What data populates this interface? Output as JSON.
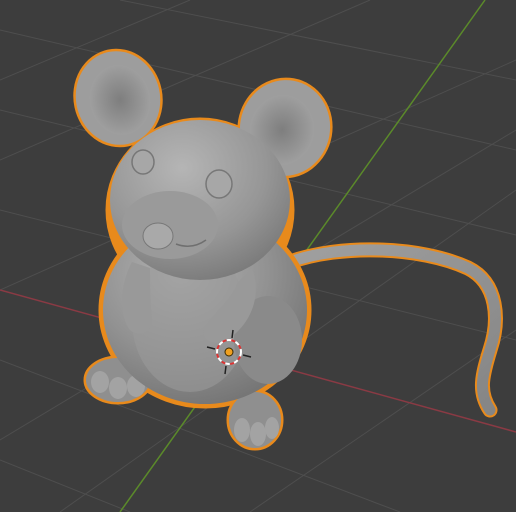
{
  "viewport": {
    "editor": "3D Viewport",
    "background_color": "#3d3d3d",
    "grid_color": "#4e4e4e",
    "x_axis_color": "#8a3a44",
    "y_axis_color": "#5b8a2a"
  },
  "scene": {
    "selected_object": {
      "kind": "mouse-sculpt",
      "selected": true,
      "outline_color": "#e88a1c",
      "surface_color": "#8c8c8c"
    },
    "origin_marker_icon": "object-origin-icon",
    "cursor_icon": "3d-cursor-icon"
  }
}
